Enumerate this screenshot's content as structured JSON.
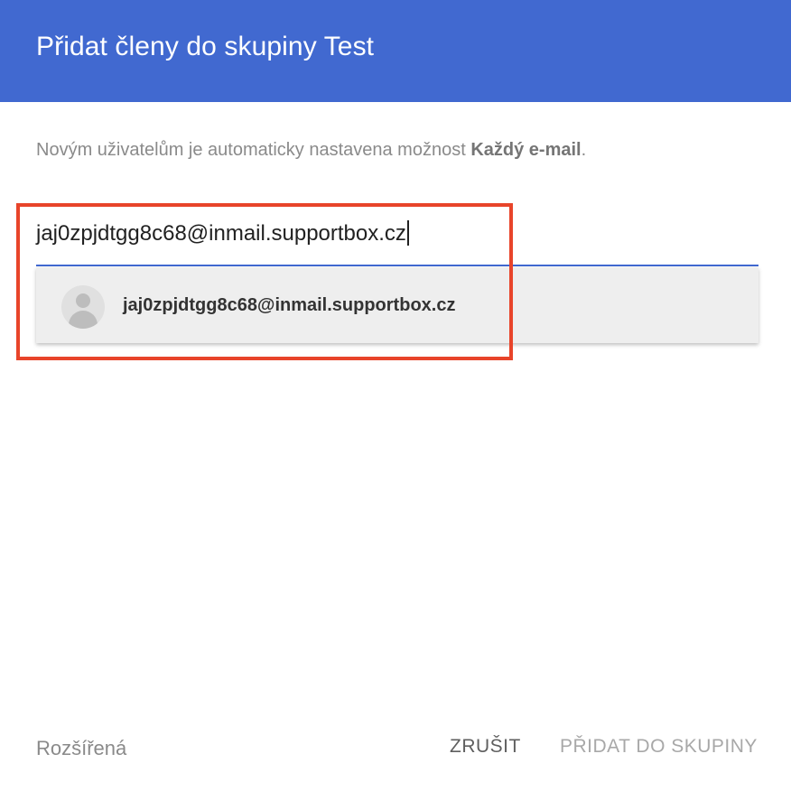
{
  "dialog": {
    "title": "Přidat členy do skupiny Test",
    "info_prefix": "Novým uživatelům je automaticky nastavena možnost ",
    "info_option": "Každý e-mail",
    "info_suffix": ".",
    "accent_color": "#4169d0"
  },
  "member_input": {
    "value": "jaj0zpjdtgg8c68@inmail.supportbox.cz"
  },
  "suggestions": [
    {
      "email": "jaj0zpjdtgg8c68@inmail.supportbox.cz",
      "icon": "avatar-placeholder-icon"
    }
  ],
  "highlight": {
    "color": "#e8442a"
  },
  "footer": {
    "advanced_label": "Rozšířená",
    "cancel_label": "ZRUŠIT",
    "add_label": "PŘIDAT DO SKUPINY"
  }
}
